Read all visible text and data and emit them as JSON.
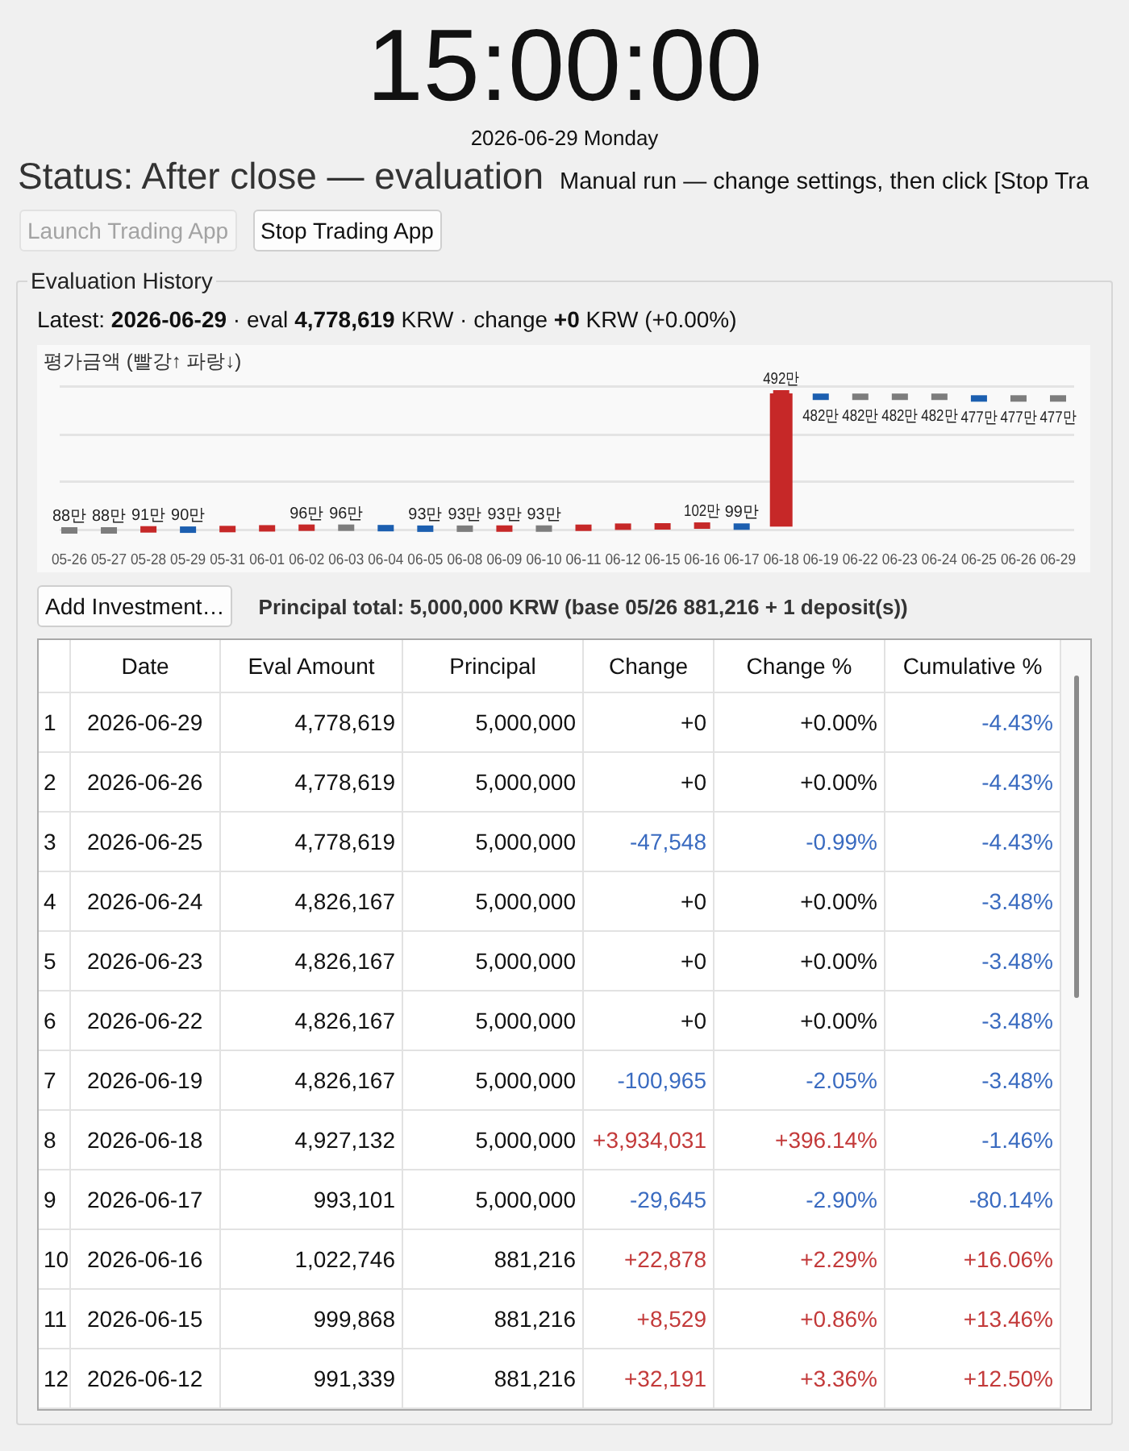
{
  "clock": {
    "time": "15:00:00",
    "date": "2026-06-29 Monday"
  },
  "status": {
    "text": "Status: After close — evaluation",
    "hint": "Manual run — change settings, then click [Stop Tra"
  },
  "buttons": [
    {
      "label": "Launch Trading App",
      "disabled": true
    },
    {
      "label": "Stop Trading App",
      "disabled": false
    }
  ],
  "history": {
    "title": "Evaluation History",
    "latest": "Latest: **2026-06-29** · eval **4,778,619** KRW · change **+0** KRW (+0.00%)",
    "chart": {
      "chart_data": {
        "type": "scatter",
        "title": "평가금액 (빨강↑ 파랑↓)",
        "categories": [
          "05-26",
          "05-27",
          "05-28",
          "05-29",
          "05-31",
          "06-01",
          "06-02",
          "06-03",
          "06-04",
          "06-05",
          "06-08",
          "06-09",
          "06-10",
          "06-11",
          "06-12",
          "06-15",
          "06-16",
          "06-17",
          "06-18",
          "06-19",
          "06-22",
          "06-23",
          "06-24",
          "06-25",
          "06-26",
          "06-29"
        ],
        "values": [
          88.12,
          88.12,
          91.2,
          90.3,
          92.1,
          94.2,
          96.1,
          96.1,
          94.8,
          93.2,
          93.2,
          93.5,
          93.5,
          95.91,
          99.13,
          99.99,
          102.27,
          99.31,
          492,
          482,
          482,
          482,
          482,
          477,
          477,
          477
        ],
        "value_labels": [
          "88만",
          "88만",
          "91만",
          "90만",
          null,
          null,
          "96만",
          "96만",
          null,
          "93만",
          "93만",
          "93만",
          "93만",
          null,
          null,
          null,
          "102만",
          "99만",
          "492만",
          "482만",
          "482만",
          "482만",
          "482만",
          "477만",
          "477만",
          "477만"
        ]
      }
    },
    "add_button": {
      "label": "Add Investment…"
    },
    "principal_total": "Principal total: 5,000,000 KRW (base 05/26 881,216 + 1 deposit(s))",
    "table": {
      "columns": [
        "Date",
        "Eval Amount",
        "Principal",
        "Change",
        "Change %",
        "Cumulative %"
      ],
      "rows": [
        {
          "index": "1",
          "date": "2026-06-29",
          "eval": "4,778,619",
          "principal": "5,000,000",
          "change": {
            "text": "+0",
            "color": "#111111"
          },
          "change_pct": {
            "text": "+0.00%",
            "color": "#111111"
          },
          "cumulative": {
            "text": "-4.43%",
            "color": "#3a6bc0"
          }
        },
        {
          "index": "2",
          "date": "2026-06-26",
          "eval": "4,778,619",
          "principal": "5,000,000",
          "change": {
            "text": "+0",
            "color": "#111111"
          },
          "change_pct": {
            "text": "+0.00%",
            "color": "#111111"
          },
          "cumulative": {
            "text": "-4.43%",
            "color": "#3a6bc0"
          }
        },
        {
          "index": "3",
          "date": "2026-06-25",
          "eval": "4,778,619",
          "principal": "5,000,000",
          "change": {
            "text": "-47,548",
            "color": "#3a6bc0"
          },
          "change_pct": {
            "text": "-0.99%",
            "color": "#3a6bc0"
          },
          "cumulative": {
            "text": "-4.43%",
            "color": "#3a6bc0"
          }
        },
        {
          "index": "4",
          "date": "2026-06-24",
          "eval": "4,826,167",
          "principal": "5,000,000",
          "change": {
            "text": "+0",
            "color": "#111111"
          },
          "change_pct": {
            "text": "+0.00%",
            "color": "#111111"
          },
          "cumulative": {
            "text": "-3.48%",
            "color": "#3a6bc0"
          }
        },
        {
          "index": "5",
          "date": "2026-06-23",
          "eval": "4,826,167",
          "principal": "5,000,000",
          "change": {
            "text": "+0",
            "color": "#111111"
          },
          "change_pct": {
            "text": "+0.00%",
            "color": "#111111"
          },
          "cumulative": {
            "text": "-3.48%",
            "color": "#3a6bc0"
          }
        },
        {
          "index": "6",
          "date": "2026-06-22",
          "eval": "4,826,167",
          "principal": "5,000,000",
          "change": {
            "text": "+0",
            "color": "#111111"
          },
          "change_pct": {
            "text": "+0.00%",
            "color": "#111111"
          },
          "cumulative": {
            "text": "-3.48%",
            "color": "#3a6bc0"
          }
        },
        {
          "index": "7",
          "date": "2026-06-19",
          "eval": "4,826,167",
          "principal": "5,000,000",
          "change": {
            "text": "-100,965",
            "color": "#3a6bc0"
          },
          "change_pct": {
            "text": "-2.05%",
            "color": "#3a6bc0"
          },
          "cumulative": {
            "text": "-3.48%",
            "color": "#3a6bc0"
          }
        },
        {
          "index": "8",
          "date": "2026-06-18",
          "eval": "4,927,132",
          "principal": "5,000,000",
          "change": {
            "text": "+3,934,031",
            "color": "#c33a3a"
          },
          "change_pct": {
            "text": "+396.14%",
            "color": "#c33a3a"
          },
          "cumulative": {
            "text": "-1.46%",
            "color": "#3a6bc0"
          }
        },
        {
          "index": "9",
          "date": "2026-06-17",
          "eval": "993,101",
          "principal": "5,000,000",
          "change": {
            "text": "-29,645",
            "color": "#3a6bc0"
          },
          "change_pct": {
            "text": "-2.90%",
            "color": "#3a6bc0"
          },
          "cumulative": {
            "text": "-80.14%",
            "color": "#3a6bc0"
          }
        },
        {
          "index": "10",
          "date": "2026-06-16",
          "eval": "1,022,746",
          "principal": "881,216",
          "change": {
            "text": "+22,878",
            "color": "#c33a3a"
          },
          "change_pct": {
            "text": "+2.29%",
            "color": "#c33a3a"
          },
          "cumulative": {
            "text": "+16.06%",
            "color": "#c33a3a"
          }
        },
        {
          "index": "11",
          "date": "2026-06-15",
          "eval": "999,868",
          "principal": "881,216",
          "change": {
            "text": "+8,529",
            "color": "#c33a3a"
          },
          "change_pct": {
            "text": "+0.86%",
            "color": "#c33a3a"
          },
          "cumulative": {
            "text": "+13.46%",
            "color": "#c33a3a"
          }
        },
        {
          "index": "12",
          "date": "2026-06-12",
          "eval": "991,339",
          "principal": "881,216",
          "change": {
            "text": "+32,191",
            "color": "#c33a3a"
          },
          "change_pct": {
            "text": "+3.36%",
            "color": "#c33a3a"
          },
          "cumulative": {
            "text": "+12.50%",
            "color": "#c33a3a"
          }
        }
      ]
    }
  }
}
